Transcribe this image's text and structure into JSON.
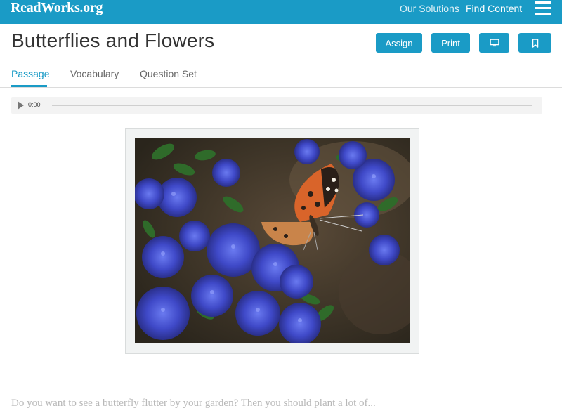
{
  "header": {
    "logo": "ReadWorks.org",
    "nav": [
      {
        "label": "Our Solutions"
      },
      {
        "label": "Find Content"
      }
    ],
    "menu_icon": "hamburger-menu-icon",
    "background_color": "#1a9bc6"
  },
  "article": {
    "title": "Butterflies and Flowers",
    "actions": {
      "assign_label": "Assign",
      "print_label": "Print",
      "present_icon": "monitor-icon",
      "bookmark_icon": "bookmark-icon"
    }
  },
  "tabs": [
    {
      "label": "Passage",
      "active": true
    },
    {
      "label": "Vocabulary",
      "active": false
    },
    {
      "label": "Question Set",
      "active": false
    }
  ],
  "audio": {
    "time": "0:00",
    "play_icon": "play-icon",
    "progress": 0
  },
  "image": {
    "subject": "painted lady butterfly on blue ceanothus flowers"
  },
  "passage": {
    "first_line": "Do you want to see a butterfly flutter by your garden? Then you should plant a lot of..."
  },
  "colors": {
    "accent": "#1a9bc6",
    "title": "#333333",
    "inactive_tab": "#666666"
  }
}
